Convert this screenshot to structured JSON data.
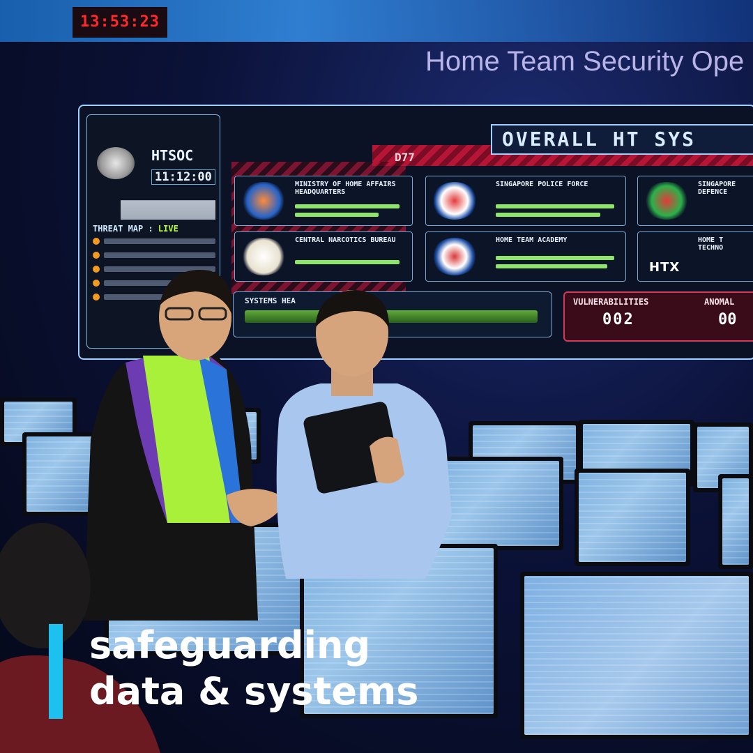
{
  "scene": {
    "clock_text": "13:53:23",
    "wall_title": "Home Team Security Ope"
  },
  "dashboard": {
    "site_label": "HTSOC",
    "site_time": "11:12:00",
    "threat_map_title": "THREAT MAP : ",
    "threat_map_status": "LIVE",
    "banner": "OVERALL HT SYS",
    "banner_code": "D77",
    "agencies": [
      {
        "name": "MINISTRY OF HOME AFFAIRS HEADQUARTERS"
      },
      {
        "name": "SINGAPORE POLICE FORCE"
      },
      {
        "name": "SINGAPORE DEFENCE"
      },
      {
        "name": "CENTRAL NARCOTICS BUREAU"
      },
      {
        "name": "HOME TEAM ACADEMY"
      },
      {
        "name": "HOME T TECHNO"
      }
    ],
    "htx_label": "HTX",
    "systems_label": "SYSTEMS HEA",
    "vulnerabilities_label": "VULNERABILITIES",
    "vulnerabilities_value": "002",
    "anomalies_label": "ANOMAL",
    "anomalies_value": "00"
  },
  "caption": {
    "line1": "safeguarding",
    "line2": "data & systems",
    "accent_color": "#1cc1f0"
  }
}
